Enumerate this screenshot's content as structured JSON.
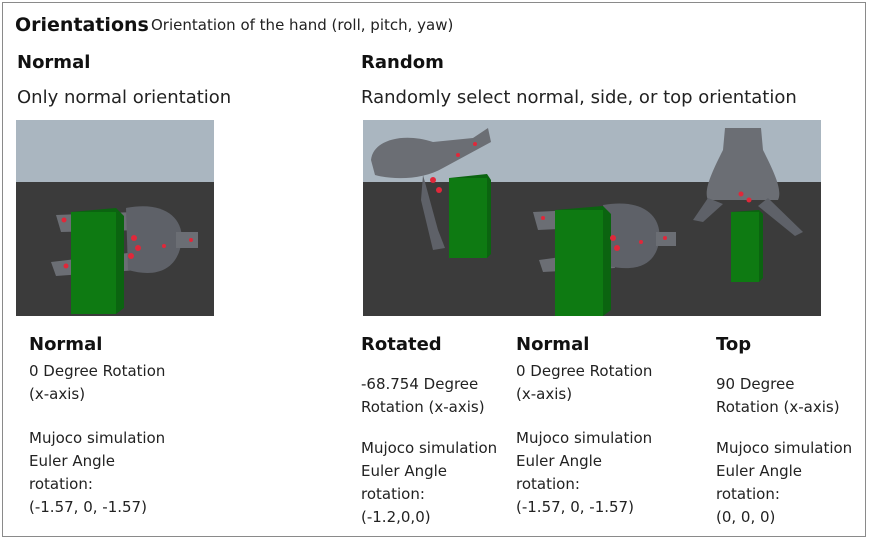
{
  "header": {
    "title": "Orientations",
    "subtitle": "Orientation of the hand (roll, pitch, yaw)"
  },
  "normal_section": {
    "heading": "Normal",
    "description": "Only normal orientation"
  },
  "random_section": {
    "heading": "Random",
    "description": "Randomly select normal, side, or top orientation"
  },
  "captions": [
    {
      "heading": "Normal",
      "rotation": "0 Degree Rotation\n(x-axis)",
      "euler": "Mujoco simulation\nEuler Angle\nrotation:\n(-1.57, 0, -1.57)"
    },
    {
      "heading": "Rotated",
      "rotation": "-68.754 Degree\nRotation (x-axis)",
      "euler": "Mujoco simulation\nEuler Angle\nrotation:\n(-1.2,0,0)"
    },
    {
      "heading": "Normal",
      "rotation": "0 Degree Rotation\n(x-axis)",
      "euler": "Mujoco simulation\nEuler Angle\nrotation:\n(-1.57, 0, -1.57)"
    },
    {
      "heading": "Top",
      "rotation": "90 Degree\nRotation (x-axis)",
      "euler": "Mujoco simulation\nEuler Angle\nrotation:\n(0, 0, 0)"
    }
  ],
  "colors": {
    "sky": "#aab6c0",
    "floor": "#3b3b3b",
    "block": "#0e7a12",
    "hand": "#6b6e74",
    "markers": "#e0283a"
  }
}
